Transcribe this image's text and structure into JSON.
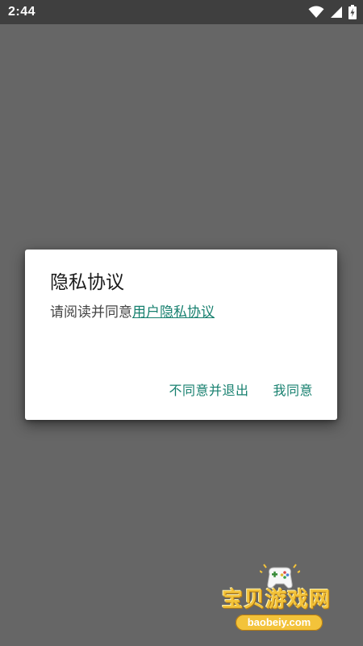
{
  "status_bar": {
    "time": "2:44",
    "icons": [
      "wifi-icon",
      "cellular-signal-icon",
      "battery-charging-icon"
    ]
  },
  "dialog": {
    "title": "隐私协议",
    "message_prefix": "请阅读并同意",
    "link_text": "用户隐私协议",
    "buttons": {
      "disagree": "不同意并退出",
      "agree": "我同意"
    }
  },
  "watermark": {
    "brand": "宝贝游戏网",
    "url": "baobeiy.com"
  },
  "colors": {
    "scrim": "#666666",
    "status_bar": "#3f3f3f",
    "accent": "#17806f",
    "watermark": "#f3c33a"
  }
}
